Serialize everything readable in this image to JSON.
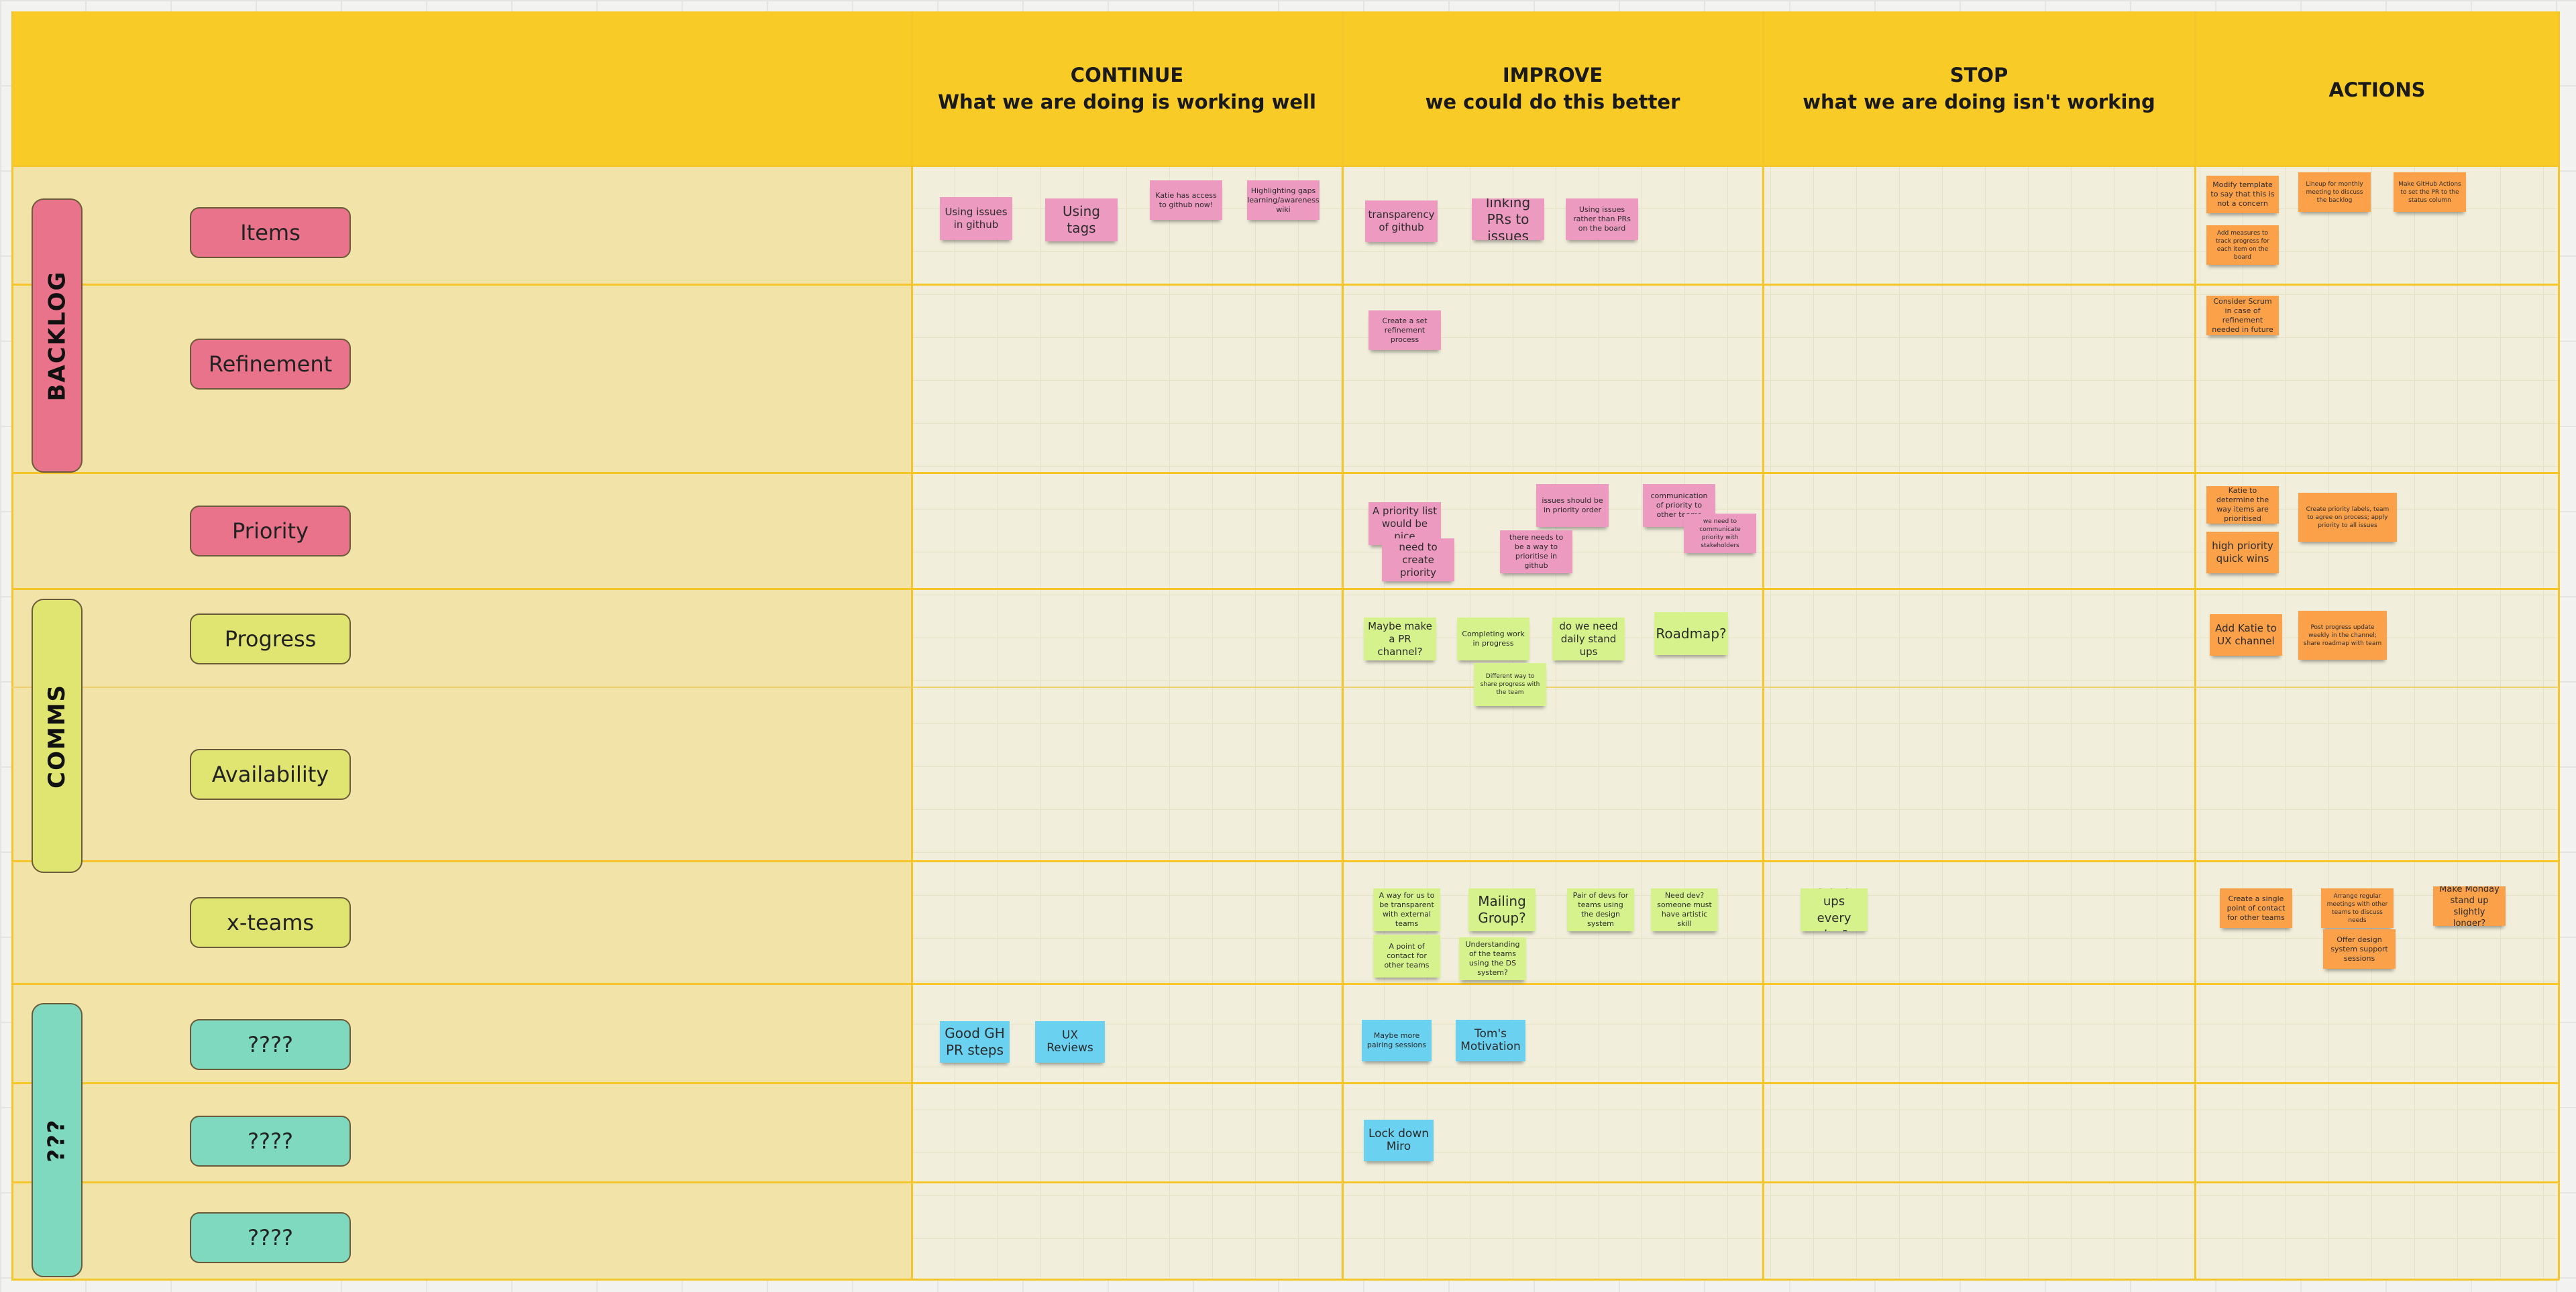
{
  "board": {
    "columns": [
      {
        "title": "CONTINUE",
        "subtitle": "What we are doing is working well"
      },
      {
        "title": "IMPROVE",
        "subtitle": "we could do this better"
      },
      {
        "title": "STOP",
        "subtitle": "what we are doing isn't working"
      },
      {
        "title": "ACTIONS",
        "subtitle": ""
      }
    ],
    "groups": [
      {
        "label": "BACKLOG",
        "color": "#e8738a"
      },
      {
        "label": "COMMS",
        "color": "#dfe570"
      },
      {
        "label": "???",
        "color": "#7fd9bf"
      }
    ],
    "rows": [
      {
        "label": "Items",
        "group": "BACKLOG"
      },
      {
        "label": "Refinement",
        "group": "BACKLOG"
      },
      {
        "label": "Priority",
        "group": "BACKLOG"
      },
      {
        "label": "Progress",
        "group": "COMMS"
      },
      {
        "label": "Availability",
        "group": "COMMS"
      },
      {
        "label": "x-teams",
        "group": "COMMS"
      },
      {
        "label": "????",
        "group": "???"
      },
      {
        "label": "????",
        "group": "???"
      },
      {
        "label": "????",
        "group": "???"
      }
    ],
    "colors": {
      "header": "#f8cb27",
      "row_label_zone": "#f2e4a8",
      "grid": "#f1eedb",
      "sticky_pink": "#ec9ac0",
      "sticky_green": "#d6f28c",
      "sticky_blue": "#6ad1f0",
      "sticky_orange": "#fba14a"
    }
  },
  "stickies": {
    "continue_items": [
      "Using issues in github",
      "Using tags",
      "Katie has access to github now!",
      "Highlighting gaps learning/awareness wiki"
    ],
    "improve_items": [
      "transparency of github",
      "linking PRs to issues",
      "Using issues rather than PRs on the board"
    ],
    "improve_refinement": [
      "Create a set refinement process"
    ],
    "improve_priority": [
      "A priority list would be nice",
      "need to create priority",
      "issues should be in priority order",
      "there needs to be a way to prioritise in github",
      "communication of priority to other teams",
      "we need to communicate priority with stakeholders"
    ],
    "improve_progress": [
      "Maybe make a PR channel?",
      "Completing work in progress",
      "do we need daily stand ups",
      "Roadmap?",
      "Different way to share progress with the team"
    ],
    "improve_xteams": [
      "A way for us to be transparent with external teams",
      "Mailing Group?",
      "Pair of devs for teams using the design system",
      "Need dev? someone must have artistic skill",
      "A point of contact for other teams",
      "Understanding of the teams using the DS system?"
    ],
    "stop_xteams": [
      "stand ups every day?"
    ],
    "continue_q1": [
      "Good GH PR steps",
      "UX Reviews"
    ],
    "improve_q1": [
      "Maybe more pairing sessions",
      "Tom's Motivation"
    ],
    "improve_q2": [
      "Lock down Miro"
    ],
    "actions_items": [
      "Modify template to say that this is not a concern",
      "Lineup for monthly meeting to discuss the backlog",
      "Make GitHub Actions to set the PR to the status column",
      "Add measures to track progress for each item on the board"
    ],
    "actions_refinement": [
      "Consider Scrum in case of refinement needed in future"
    ],
    "actions_priority": [
      "Katie to determine the way items are prioritised",
      "high priority quick wins",
      "Create priority labels, team to agree on process; apply priority to all issues"
    ],
    "actions_progress": [
      "Add Katie to UX channel",
      "Post progress update weekly in the channel; share roadmap with team"
    ],
    "actions_xteams": [
      "Create a single point of contact for other teams",
      "Arrange regular meetings with other teams to discuss needs",
      "Offer design system support sessions",
      "Make Monday stand up slightly longer?"
    ]
  }
}
